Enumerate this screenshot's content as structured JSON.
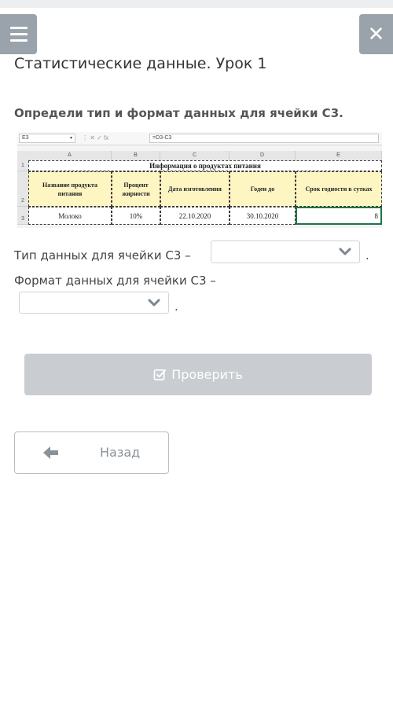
{
  "header": {
    "menu_icon": "hamburger-menu-icon",
    "close_icon": "close-icon",
    "close_glyph": "✕"
  },
  "page": {
    "title": "Статистические данные. Урок 1",
    "question": "Определи тип и формат данных для ячейки С3."
  },
  "spreadsheet": {
    "name_box": "E3",
    "name_box_dropdown": "▾",
    "formula_icons": "⋮   ✕   ✓   fx",
    "formula": "=D3-C3",
    "columns": [
      "A",
      "B",
      "C",
      "D",
      "E"
    ],
    "rows": [
      "1",
      "2",
      "3"
    ],
    "table_title": "Информация о продуктах питания",
    "headers": [
      "Название продукта питания",
      "Процент жирности",
      "Дата изготовления",
      "Годен до",
      "Срок годности в сутках"
    ],
    "values": [
      "Молоко",
      "10%",
      "22.10.2020",
      "30.10.2020",
      "8"
    ],
    "header_fill": "#fdf6c3",
    "selected_border": "#217346"
  },
  "form": {
    "q1_label": "Тип данных для ячейки С3 –",
    "q1_value": "",
    "q1_end": ".",
    "q2_label": "Формат данных для ячейки С3 –",
    "q2_value": "",
    "q2_end": ".",
    "chevron_icon": "chevron-down-icon"
  },
  "actions": {
    "check_label": "Проверить",
    "check_icon": "check-square-icon",
    "back_label": "Назад",
    "back_icon": "arrow-left-icon",
    "check_disabled_color": "#c9ccd0"
  }
}
